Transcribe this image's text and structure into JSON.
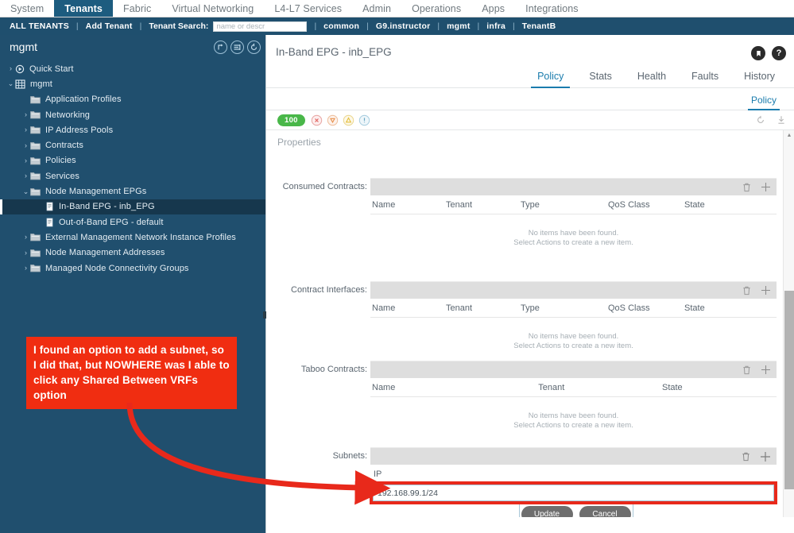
{
  "topnav": {
    "items": [
      {
        "label": "System",
        "active": false
      },
      {
        "label": "Tenants",
        "active": true
      },
      {
        "label": "Fabric",
        "active": false
      },
      {
        "label": "Virtual Networking",
        "active": false
      },
      {
        "label": "L4-L7 Services",
        "active": false
      },
      {
        "label": "Admin",
        "active": false
      },
      {
        "label": "Operations",
        "active": false
      },
      {
        "label": "Apps",
        "active": false
      },
      {
        "label": "Integrations",
        "active": false
      }
    ]
  },
  "tenantbar": {
    "all_tenants": "ALL TENANTS",
    "add_tenant": "Add Tenant",
    "search_label": "Tenant Search:",
    "search_placeholder": "name or descr",
    "search_value": "",
    "separator": "|",
    "tenants": [
      "common",
      "G9.instructor",
      "mgmt",
      "infra",
      "TenantB"
    ]
  },
  "sidebar": {
    "title": "mgmt",
    "header_icons": [
      "collapse-all-icon",
      "filter-icon",
      "refresh-icon"
    ],
    "tree": [
      {
        "label": "Quick Start",
        "indent": 0,
        "chevron": ">",
        "icon": "quickstart-icon",
        "selected": false
      },
      {
        "label": "mgmt",
        "indent": 0,
        "chevron": "v",
        "icon": "tenant-icon",
        "selected": false
      },
      {
        "label": "Application Profiles",
        "indent": 1,
        "chevron": "",
        "icon": "folder-icon",
        "selected": false
      },
      {
        "label": "Networking",
        "indent": 1,
        "chevron": ">",
        "icon": "folder-icon",
        "selected": false
      },
      {
        "label": "IP Address Pools",
        "indent": 1,
        "chevron": ">",
        "icon": "folder-icon",
        "selected": false
      },
      {
        "label": "Contracts",
        "indent": 1,
        "chevron": ">",
        "icon": "folder-icon",
        "selected": false
      },
      {
        "label": "Policies",
        "indent": 1,
        "chevron": ">",
        "icon": "folder-icon",
        "selected": false
      },
      {
        "label": "Services",
        "indent": 1,
        "chevron": ">",
        "icon": "folder-icon",
        "selected": false
      },
      {
        "label": "Node Management EPGs",
        "indent": 1,
        "chevron": "v",
        "icon": "folder-icon",
        "selected": false
      },
      {
        "label": "In-Band EPG - inb_EPG",
        "indent": 2,
        "chevron": "",
        "icon": "epg-icon",
        "selected": true
      },
      {
        "label": "Out-of-Band EPG - default",
        "indent": 2,
        "chevron": "",
        "icon": "epg-icon",
        "selected": false
      },
      {
        "label": "External Management Network Instance Profiles",
        "indent": 1,
        "chevron": ">",
        "icon": "folder-icon",
        "selected": false
      },
      {
        "label": "Node Management Addresses",
        "indent": 1,
        "chevron": ">",
        "icon": "folder-icon",
        "selected": false
      },
      {
        "label": "Managed Node Connectivity Groups",
        "indent": 1,
        "chevron": ">",
        "icon": "folder-icon",
        "selected": false
      }
    ]
  },
  "main": {
    "title": "In-Band EPG - inb_EPG",
    "header_icons": [
      "bookmark-icon",
      "help-icon"
    ],
    "tabs": [
      {
        "label": "Policy",
        "active": true
      },
      {
        "label": "Stats",
        "active": false
      },
      {
        "label": "Health",
        "active": false
      },
      {
        "label": "Faults",
        "active": false
      },
      {
        "label": "History",
        "active": false
      }
    ],
    "subtabs": [
      {
        "label": "Policy",
        "active": true
      }
    ],
    "health_score": "100",
    "fault_icons": [
      "critical-fault-icon",
      "major-fault-icon",
      "minor-fault-icon",
      "warning-fault-icon"
    ],
    "toolbar_icons": [
      "refresh-icon",
      "download-icon"
    ],
    "properties_title": "Properties",
    "empty_line1": "No items have been found.",
    "empty_line2": "Select Actions to create a new item.",
    "sections": [
      {
        "label": "Consumed Contracts:",
        "columns": [
          "Name",
          "Tenant",
          "Type",
          "QoS Class",
          "State"
        ],
        "rows": []
      },
      {
        "label": "Contract Interfaces:",
        "columns": [
          "Name",
          "Tenant",
          "Type",
          "QoS Class",
          "State"
        ],
        "rows": []
      },
      {
        "label": "Taboo Contracts:",
        "columns": [
          "Name",
          "Tenant",
          "State"
        ],
        "rows": []
      }
    ],
    "subnets": {
      "label": "Subnets:",
      "column_ip": "IP",
      "ip_value": "192.168.99.1/24",
      "update_label": "Update",
      "cancel_label": "Cancel",
      "delete_icon": "trash-icon",
      "add_icon": "plus-icon"
    }
  },
  "annotation": {
    "text": "I found an option to add a subnet, so I did that, but NOWHERE was I able to click any Shared Between VRFs option",
    "color": "#f02d11",
    "arrow": "curved-arrow-to-ip-field"
  },
  "colors": {
    "nav_active": "#1d5c7f",
    "tenant_bar": "#1f4f6e",
    "sidebar": "#204f6e",
    "accent": "#1a7cad",
    "health_green": "#49b749",
    "annotation_red": "#f02d11"
  }
}
